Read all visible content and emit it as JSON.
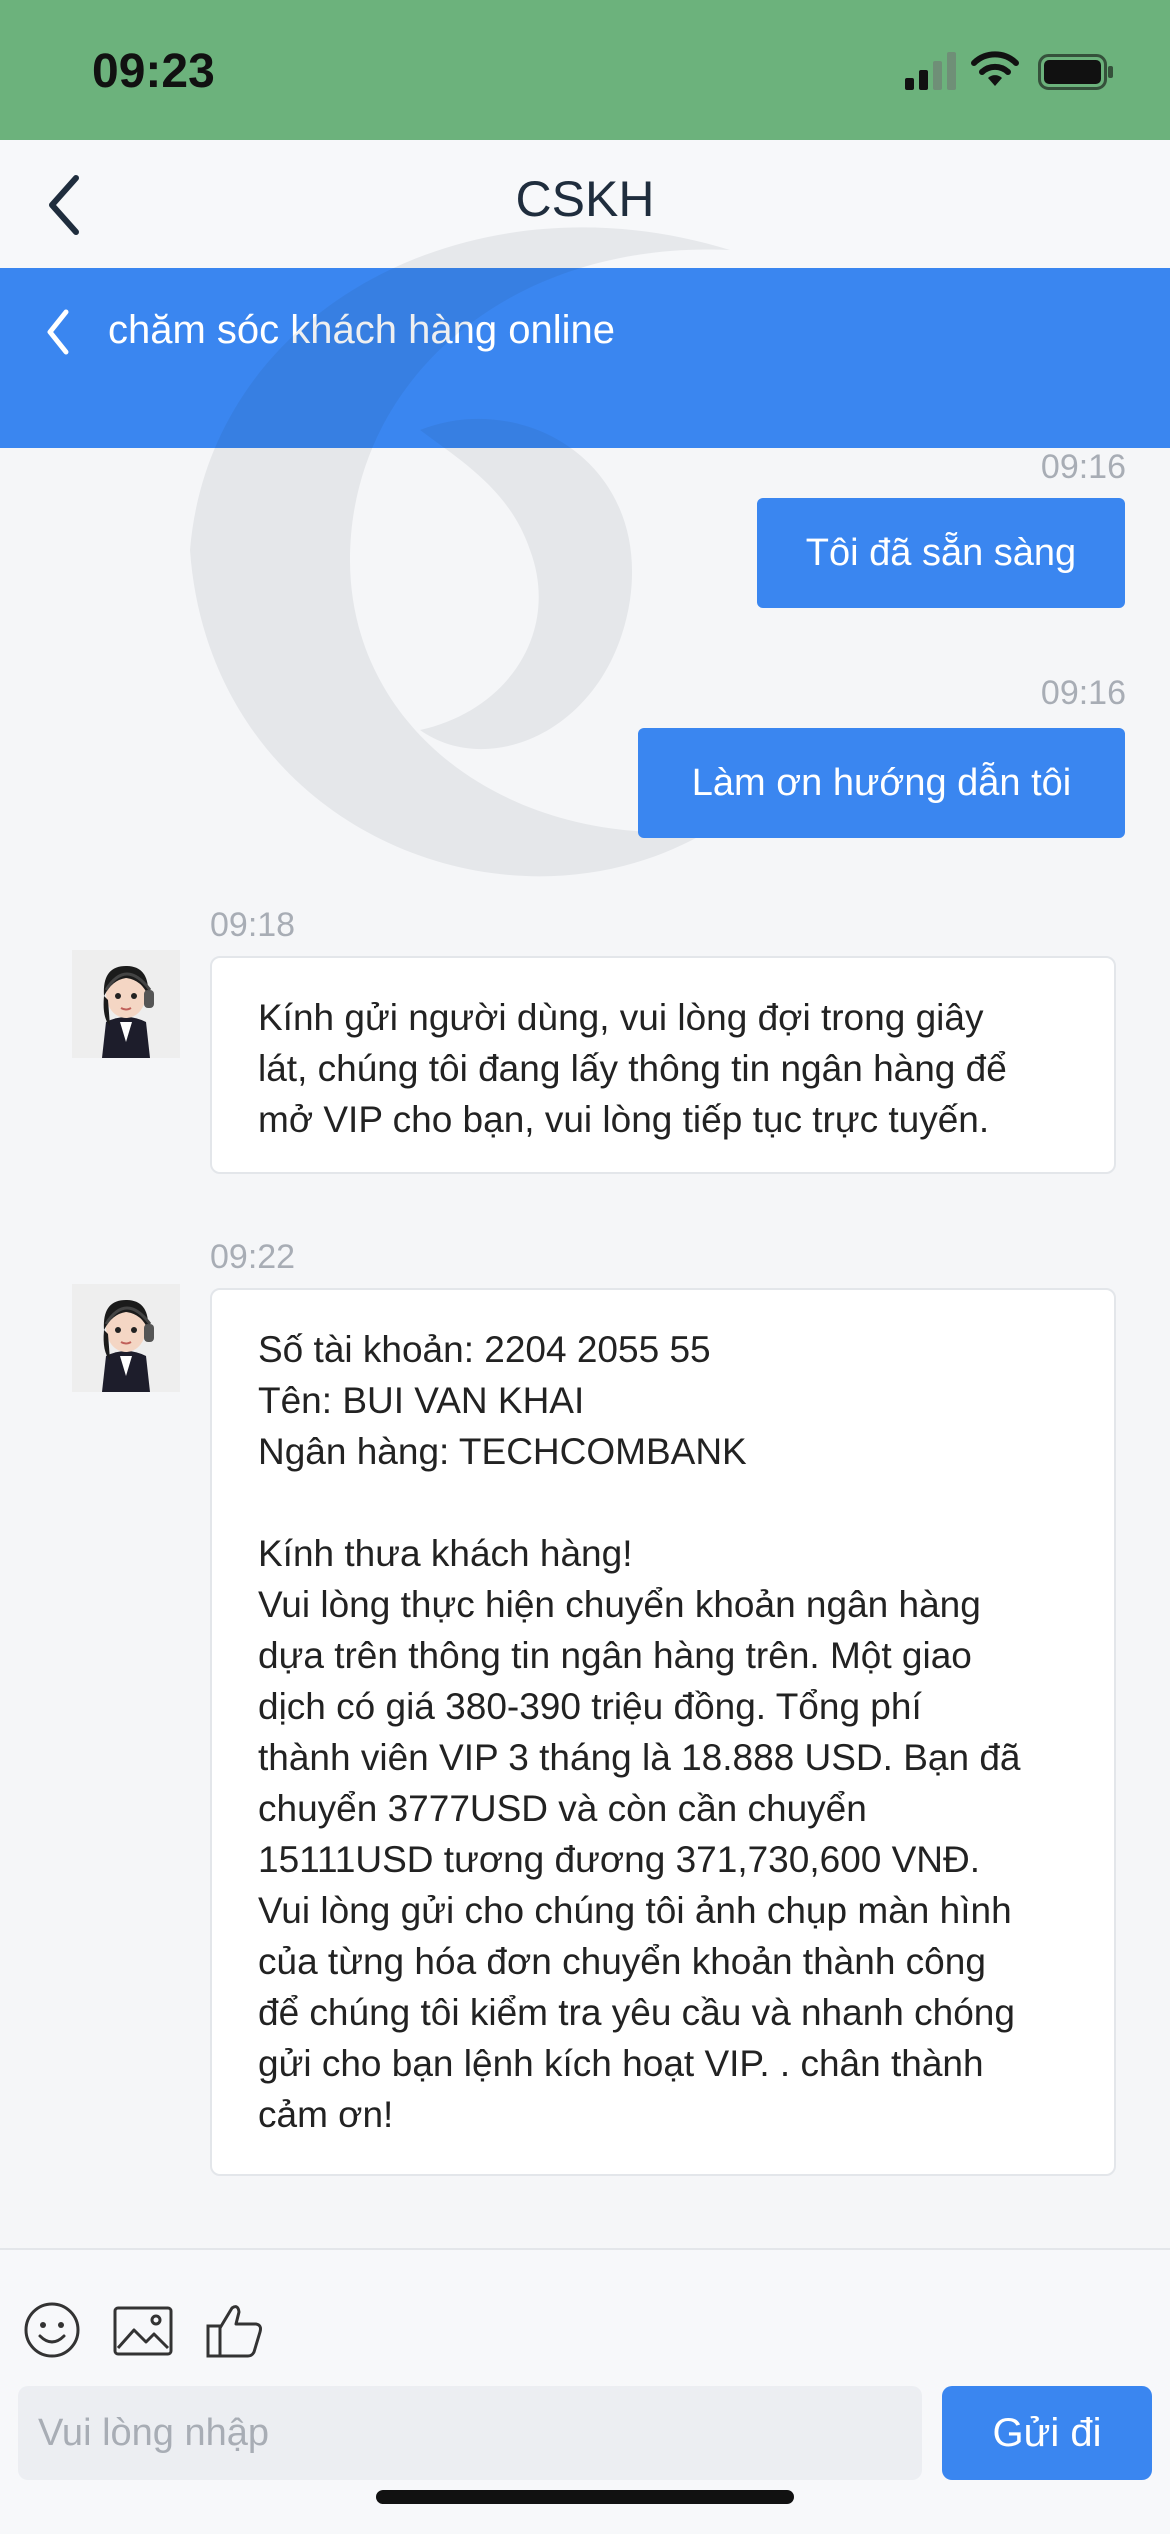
{
  "status_bar": {
    "time": "09:23"
  },
  "nav": {
    "title": "CSKH"
  },
  "sub_header": {
    "title": "chăm sóc khách hàng online"
  },
  "messages": [
    {
      "time": "09:16",
      "text": "Tôi đã sẵn sàng"
    },
    {
      "time": "09:16",
      "text": "Làm ơn hướng dẫn tôi"
    },
    {
      "time": "09:18",
      "text": "Kính gửi người dùng, vui lòng đợi trong giây\nlát, chúng tôi đang lấy thông tin ngân hàng để\nmở VIP cho bạn, vui lòng tiếp tục trực tuyến."
    },
    {
      "time": "09:22",
      "text": "Số tài khoản: 2204 2055 55\nTên: BUI VAN KHAI\nNgân hàng: TECHCOMBANK\n\nKính thưa khách hàng!\nVui lòng thực hiện chuyển khoản ngân hàng\ndựa trên thông tin ngân hàng trên. Một giao\ndịch có giá 380-390 triệu đồng. Tổng phí\nthành viên VIP 3 tháng là 18.888 USD. Bạn đã\nchuyển 3777USD và còn cần chuyển\n15111USD tương đương 371,730,600 VNĐ.\nVui lòng gửi cho chúng tôi ảnh chụp màn hình\ncủa từng hóa đơn chuyển khoản thành công\nđể chúng tôi kiểm tra yêu cầu và nhanh chóng\ngửi cho bạn lệnh kích hoạt VIP. . chân thành\ncảm ơn!"
    }
  ],
  "composer": {
    "placeholder": "Vui lòng nhập",
    "send_label": "Gửi đi",
    "icons": [
      "emoji-icon",
      "image-icon",
      "thumbs-up-icon"
    ]
  },
  "colors": {
    "accent": "#3a86f0",
    "status_bar": "#6cb27c"
  }
}
